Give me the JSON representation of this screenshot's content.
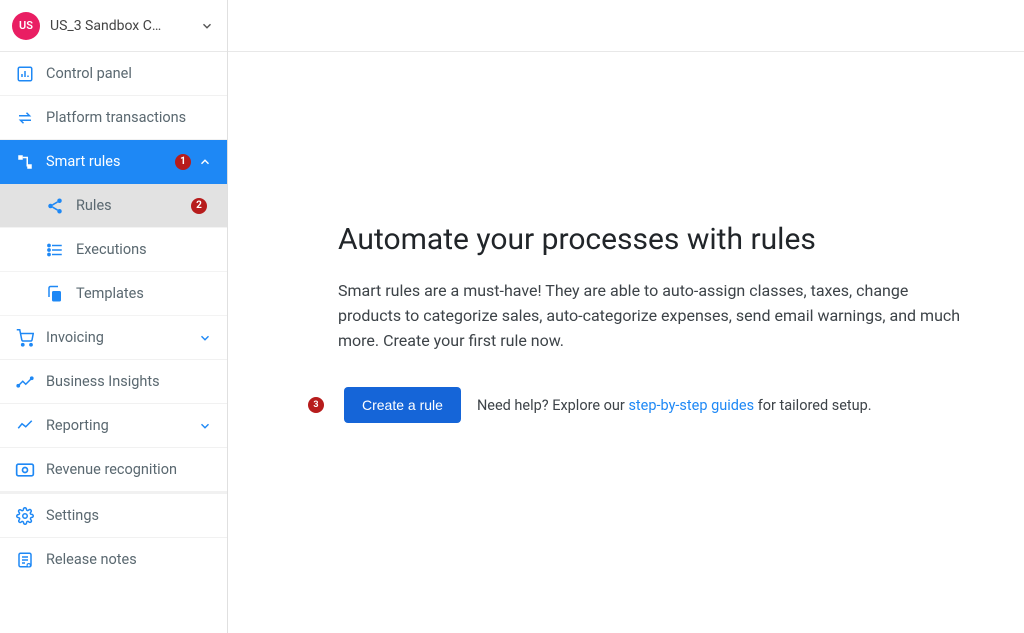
{
  "org": {
    "avatar": "US",
    "name": "US_3 Sandbox C…"
  },
  "sidebar": {
    "control_panel": "Control panel",
    "platform_transactions": "Platform transactions",
    "smart_rules": {
      "label": "Smart rules",
      "badge": "1",
      "children": {
        "rules": {
          "label": "Rules",
          "badge": "2"
        },
        "executions": {
          "label": "Executions"
        },
        "templates": {
          "label": "Templates"
        }
      }
    },
    "invoicing": "Invoicing",
    "business_insights": "Business Insights",
    "reporting": "Reporting",
    "revenue_recognition": "Revenue recognition",
    "settings": "Settings",
    "release_notes": "Release notes"
  },
  "main": {
    "heading": "Automate your processes with rules",
    "description": "Smart rules are a must-have! They are able to auto-assign classes, taxes, change products to categorize sales, auto-categorize expenses, send email warnings, and much more. Create your first rule now.",
    "cta_marker": "3",
    "cta_button": "Create a rule",
    "help_prefix": "Need help? Explore our ",
    "help_link": "step-by-step guides",
    "help_suffix": " for tailored setup."
  }
}
